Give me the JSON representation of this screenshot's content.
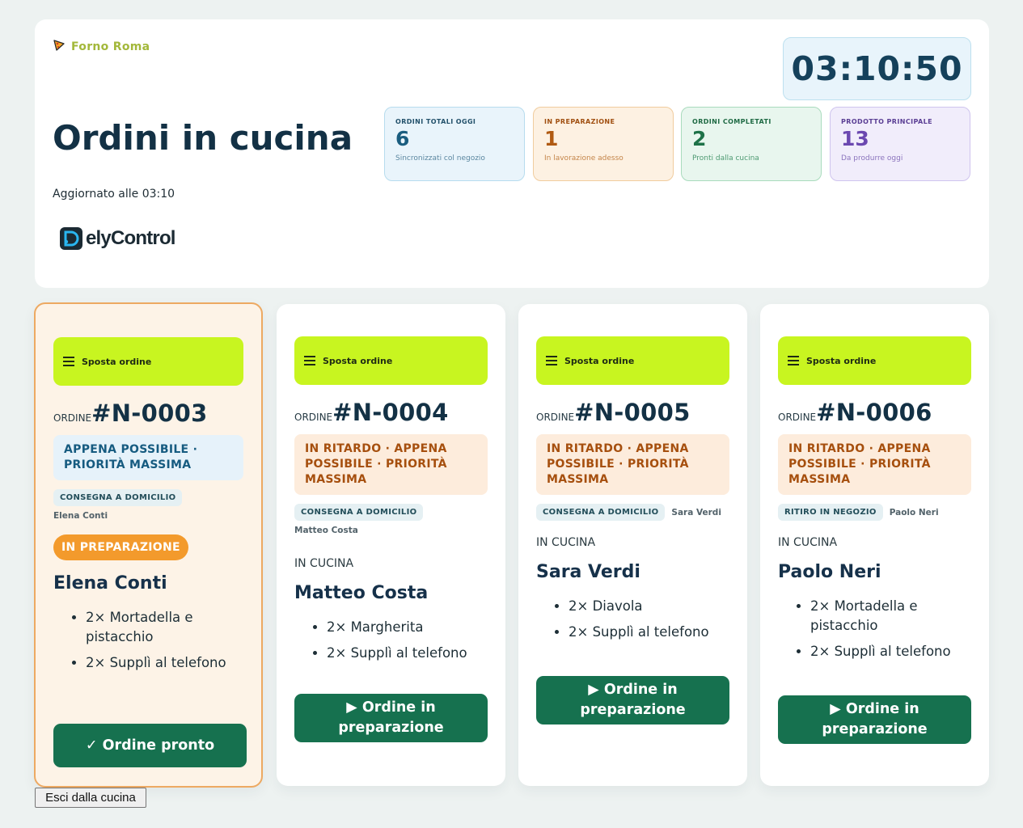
{
  "brand": {
    "name": "Forno Roma",
    "icon": "pizza-slice-icon"
  },
  "header": {
    "title": "Ordini in cucina",
    "updated": "Aggiornato alle 03:10",
    "logo": "DelyControl",
    "clock": "03:10:50"
  },
  "stats": [
    {
      "label": "ORDINI TOTALI OGGI",
      "value": "6",
      "sub": "Sincronizzati col negozio"
    },
    {
      "label": "IN PREPARAZIONE",
      "value": "1",
      "sub": "In lavorazione adesso"
    },
    {
      "label": "ORDINI COMPLETATI",
      "value": "2",
      "sub": "Pronti dalla cucina"
    },
    {
      "label": "PRODOTTO PRINCIPALE",
      "value": "13",
      "sub": "Da produrre oggi"
    }
  ],
  "orders": [
    {
      "drag_label": "Sposta ordine",
      "prefix": "ORDINE",
      "number": "#N-0003",
      "priority": "APPENA POSSIBILE · PRIORITÀ MASSIMA",
      "type": "CONSEGNA A DOMICILIO",
      "customer_small": "Elena Conti",
      "status": "IN PREPARAZIONE",
      "customer": "Elena Conti",
      "items": [
        "2× Mortadella e pistacchio",
        "2× Supplì al telefono"
      ],
      "action": "✓ Ordine pronto"
    },
    {
      "drag_label": "Sposta ordine",
      "prefix": "ORDINE",
      "number": "#N-0004",
      "priority": "IN RITARDO · APPENA POSSIBILE · PRIORITÀ MASSIMA",
      "type": "CONSEGNA A DOMICILIO",
      "customer_small": "Matteo Costa",
      "status": "IN CUCINA",
      "customer": "Matteo Costa",
      "items": [
        "2× Margherita",
        "2× Supplì al telefono"
      ],
      "action": "▶ Ordine in preparazione"
    },
    {
      "drag_label": "Sposta ordine",
      "prefix": "ORDINE",
      "number": "#N-0005",
      "priority": "IN RITARDO · APPENA POSSIBILE · PRIORITÀ MASSIMA",
      "type": "CONSEGNA A DOMICILIO",
      "customer_small": "Sara Verdi",
      "status": "IN CUCINA",
      "customer": "Sara Verdi",
      "items": [
        "2× Diavola",
        "2× Supplì al telefono"
      ],
      "action": "▶ Ordine in preparazione"
    },
    {
      "drag_label": "Sposta ordine",
      "prefix": "ORDINE",
      "number": "#N-0006",
      "priority": "IN RITARDO · APPENA POSSIBILE · PRIORITÀ MASSIMA",
      "type": "RITIRO IN NEGOZIO",
      "customer_small": "Paolo Neri",
      "status": "IN CUCINA",
      "customer": "Paolo Neri",
      "items": [
        "2× Mortadella e pistacchio",
        "2× Supplì al telefono"
      ],
      "action": "▶ Ordine in preparazione"
    }
  ],
  "exit_button": "Esci dalla cucina",
  "colors": {
    "accent_lime": "#c8f520",
    "action_green": "#16714f",
    "preparing_orange": "#f39a2c"
  }
}
